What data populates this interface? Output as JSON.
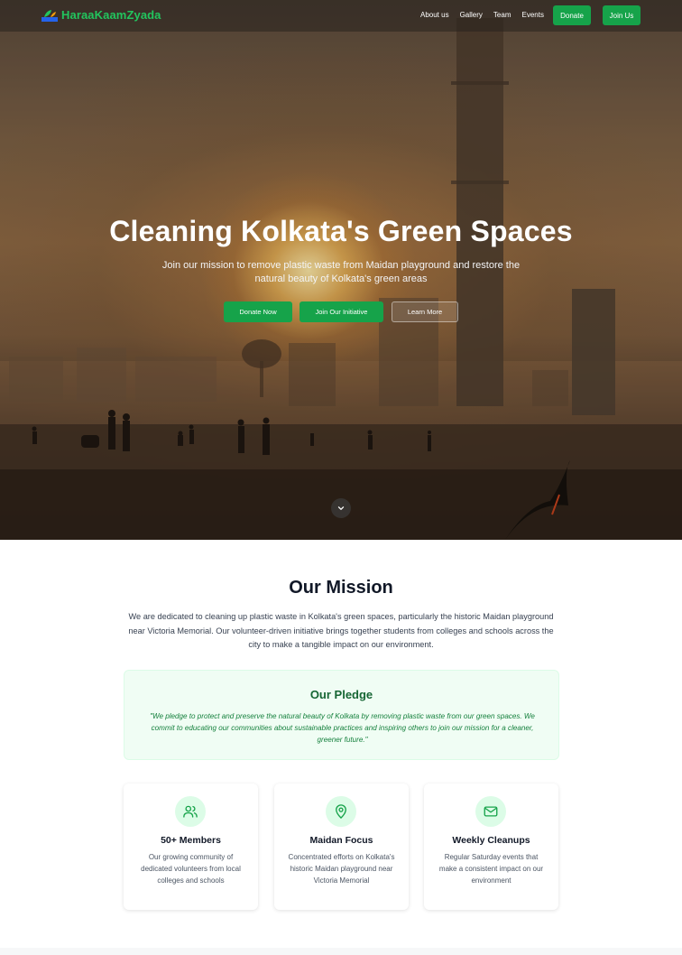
{
  "brand": {
    "name": "HaraaKaamZyada",
    "logo_icon": "leaf-logo-icon"
  },
  "nav": {
    "links": [
      "About us",
      "Gallery",
      "Team",
      "Events"
    ],
    "donate_label": "Donate",
    "join_label": "Join Us"
  },
  "hero": {
    "title": "Cleaning Kolkata's Green Spaces",
    "subtitle": "Join our mission to remove plastic waste from Maidan playground and restore the natural beauty of Kolkata's green areas",
    "buttons": {
      "donate": "Donate Now",
      "join": "Join Our Initiative",
      "learn": "Learn More"
    },
    "scroll_icon": "chevron-down-icon"
  },
  "mission": {
    "title": "Our Mission",
    "text": "We are dedicated to cleaning up plastic waste in Kolkata's green spaces, particularly the historic Maidan playground near Victoria Memorial. Our volunteer-driven initiative brings together students from colleges and schools across the city to make a tangible impact on our environment."
  },
  "pledge": {
    "title": "Our Pledge",
    "text": "\"We pledge to protect and preserve the natural beauty of Kolkata by removing plastic waste from our green spaces. We commit to educating our communities about sustainable practices and inspiring others to join our mission for a cleaner, greener future.\""
  },
  "features": [
    {
      "icon": "users-icon",
      "title": "50+ Members",
      "text": "Our growing community of dedicated volunteers from local colleges and schools"
    },
    {
      "icon": "map-pin-icon",
      "title": "Maidan Focus",
      "text": "Concentrated efforts on Kolkata's historic Maidan playground near Victoria Memorial"
    },
    {
      "icon": "mail-icon",
      "title": "Weekly Cleanups",
      "text": "Regular Saturday events that make a consistent impact on our environment"
    }
  ],
  "colors": {
    "accent": "#16a34a",
    "brand_text": "#22c55e",
    "pledge_bg": "#f0fdf4",
    "pledge_text": "#15803d"
  }
}
